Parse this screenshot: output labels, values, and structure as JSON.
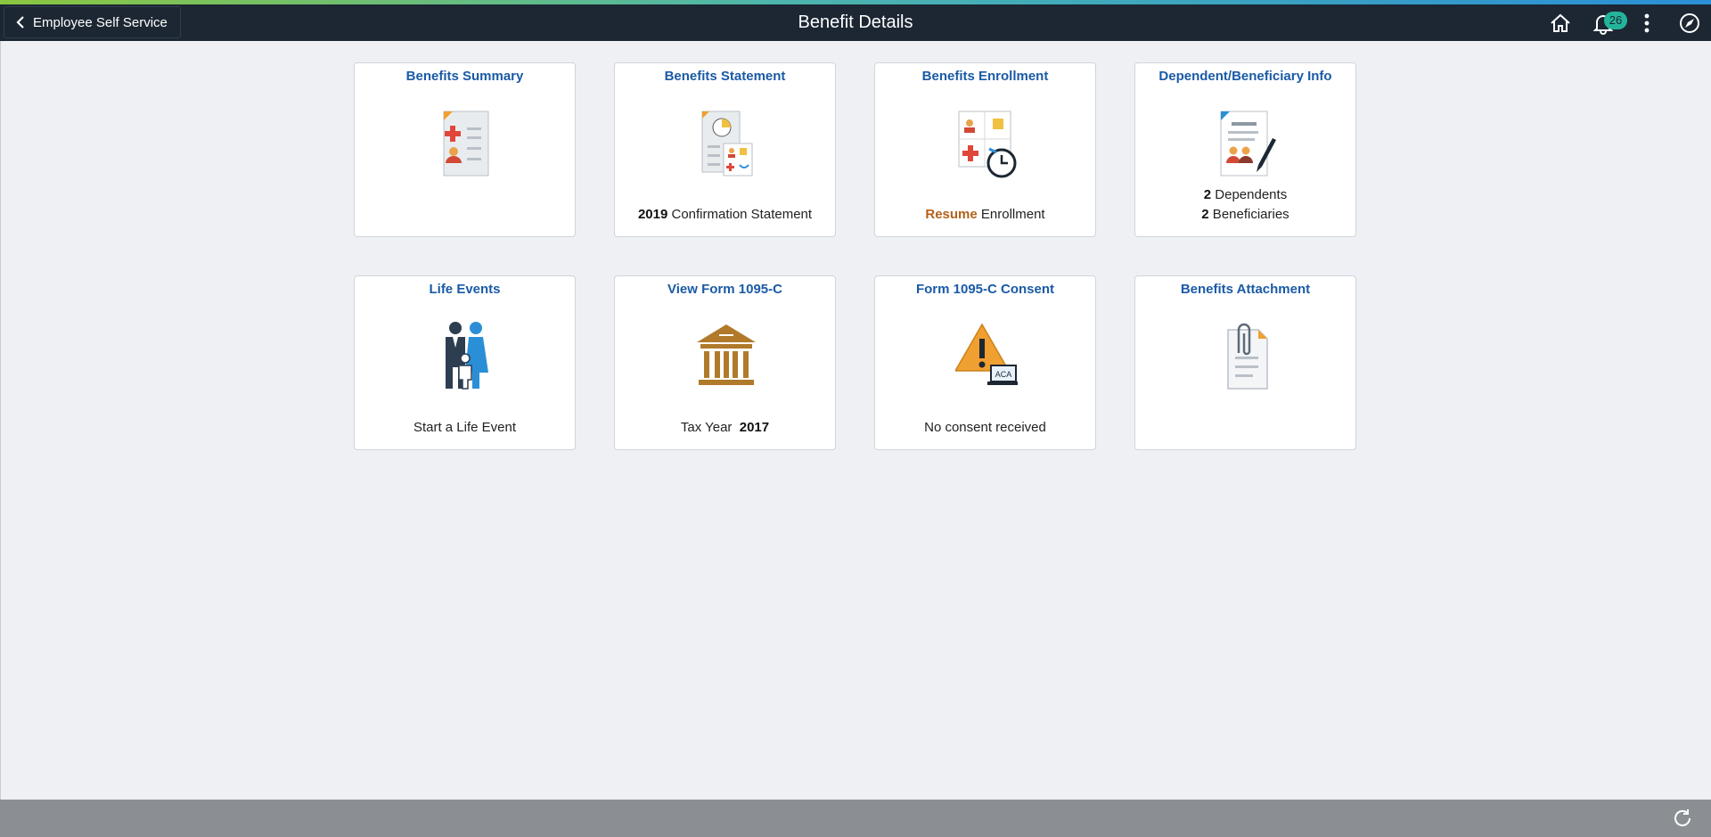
{
  "header": {
    "back_label": "Employee Self Service",
    "title": "Benefit Details",
    "notification_count": "26",
    "icons": [
      "home-icon",
      "bell-icon",
      "more-vertical-icon",
      "navbar-icon"
    ]
  },
  "tiles": [
    {
      "title": "Benefits Summary",
      "icon": "benefits-summary-icon"
    },
    {
      "title": "Benefits Statement",
      "icon": "benefits-statement-icon",
      "info_bold": "2019",
      "info_text": " Confirmation Statement"
    },
    {
      "title": "Benefits Enrollment",
      "icon": "benefits-enrollment-icon",
      "info_action": "Resume",
      "info_text": " Enrollment"
    },
    {
      "title": "Dependent/Beneficiary Info",
      "icon": "dependent-beneficiary-icon",
      "line1_bold": "2",
      "line1_text": " Dependents",
      "line2_bold": "2",
      "line2_text": " Beneficiaries"
    },
    {
      "title": "Life Events",
      "icon": "family-icon",
      "info_text": "Start a Life Event"
    },
    {
      "title": "View Form 1095-C",
      "icon": "building-columns-icon",
      "info_text": "Tax Year  ",
      "info_bold": "2017"
    },
    {
      "title": "Form 1095-C Consent",
      "icon": "warning-aca-icon",
      "info_text": "No consent received",
      "badge_text": "ACA"
    },
    {
      "title": "Benefits Attachment",
      "icon": "paperclip-document-icon"
    }
  ],
  "colors": {
    "header_bg": "#1c2733",
    "tile_title": "#1a5aa6",
    "accent_orange": "#b3611a",
    "badge": "#23b59a",
    "footer_bg": "#8b8f94"
  },
  "footer": {
    "icon": "refresh-icon"
  }
}
